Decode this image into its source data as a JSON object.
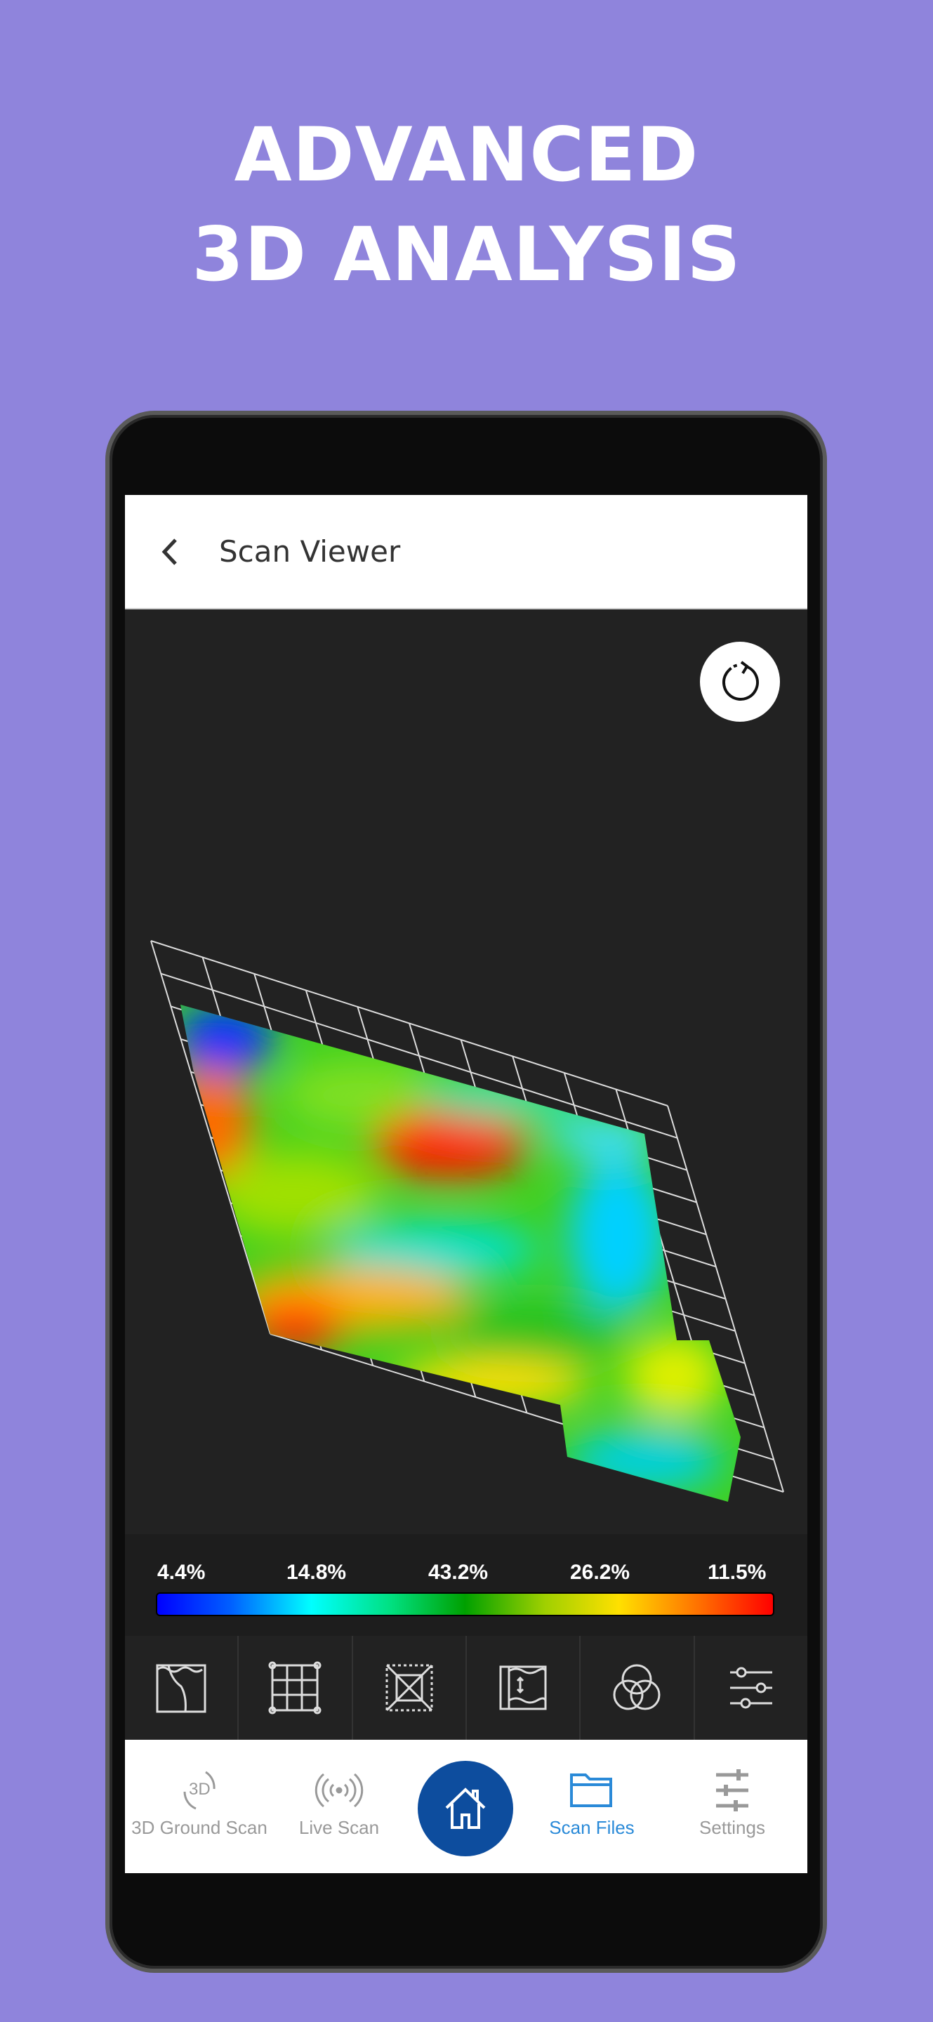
{
  "headline": {
    "line1": "ADVANCED",
    "line2": "3D ANALYSIS"
  },
  "appbar": {
    "title": "Scan Viewer",
    "back_icon": "chevron-left-icon"
  },
  "viewer": {
    "reset_icon": "rotate-reset-icon"
  },
  "legend": {
    "labels": [
      "4.4%",
      "14.8%",
      "43.2%",
      "26.2%",
      "11.5%"
    ],
    "colors": [
      "#0000ff",
      "#00ffff",
      "#00a000",
      "#ffe000",
      "#ff0000"
    ]
  },
  "tools": [
    "terrain-icon",
    "grid-icon",
    "bounding-box-icon",
    "depth-icon",
    "color-blend-icon",
    "sliders-icon"
  ],
  "nav": {
    "items": [
      {
        "label": "3D Ground Scan",
        "icon": "3d-rotate-icon"
      },
      {
        "label": "Live Scan",
        "icon": "signal-icon"
      },
      {
        "label": "Home",
        "icon": "home-icon"
      },
      {
        "label": "Scan Files",
        "icon": "folder-icon",
        "active": true
      },
      {
        "label": "Settings",
        "icon": "settings-sliders-icon"
      }
    ],
    "active_color": "#2a8ad8",
    "home_color": "#0d4d9e"
  },
  "background": "#8f84dc"
}
